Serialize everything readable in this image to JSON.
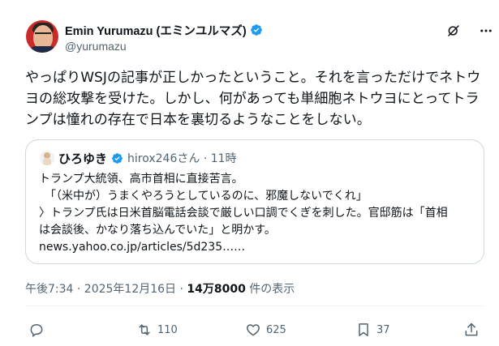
{
  "author": {
    "display_name": "Emin Yurumazu (エミンユルマズ)",
    "handle": "@yurumazu",
    "verified_icon": "verified-badge-icon"
  },
  "top_actions": {
    "grok_icon": "grok-icon",
    "more_icon": "more-horizontal-icon"
  },
  "tweet": {
    "lines": [
      "やっぱりWSJの記事が正しかったということ。それを言っただけでネトウ",
      "ヨの総攻撃を受けた。しかし、何があっても単細胞ネトウヨにとってトラ",
      "ンプは憧れの存在で日本を裏切るようなことをしない。"
    ]
  },
  "quote": {
    "name": "ひろゆき",
    "meta": "hirox246さん · 11時",
    "lines": [
      "トランプ大統領、高市首相に直接苦言。",
      "　「（米中が）うまくやろうとしているのに、邪魔しないでくれ」",
      "〉トランプ氏は日米首脳電話会談で厳しい口調でくぎを刺した。官邸筋は「首相",
      "は会談後、かなり落ち込んでいた」と明かす。",
      "news.yahoo.co.jp/articles/5d235……"
    ]
  },
  "meta": {
    "timestamp": "午後7:34 · 2025年12月16日 · ",
    "views_count": "14万8000",
    "views_label": " 件の表示"
  },
  "actions": {
    "reply_count": "",
    "retweet_count": "110",
    "like_count": "625",
    "bookmark_count": "37"
  },
  "colors": {
    "text": "#0f1419",
    "secondary": "#536471",
    "verified": "#1d9bf0",
    "border": "#cfd9de"
  }
}
